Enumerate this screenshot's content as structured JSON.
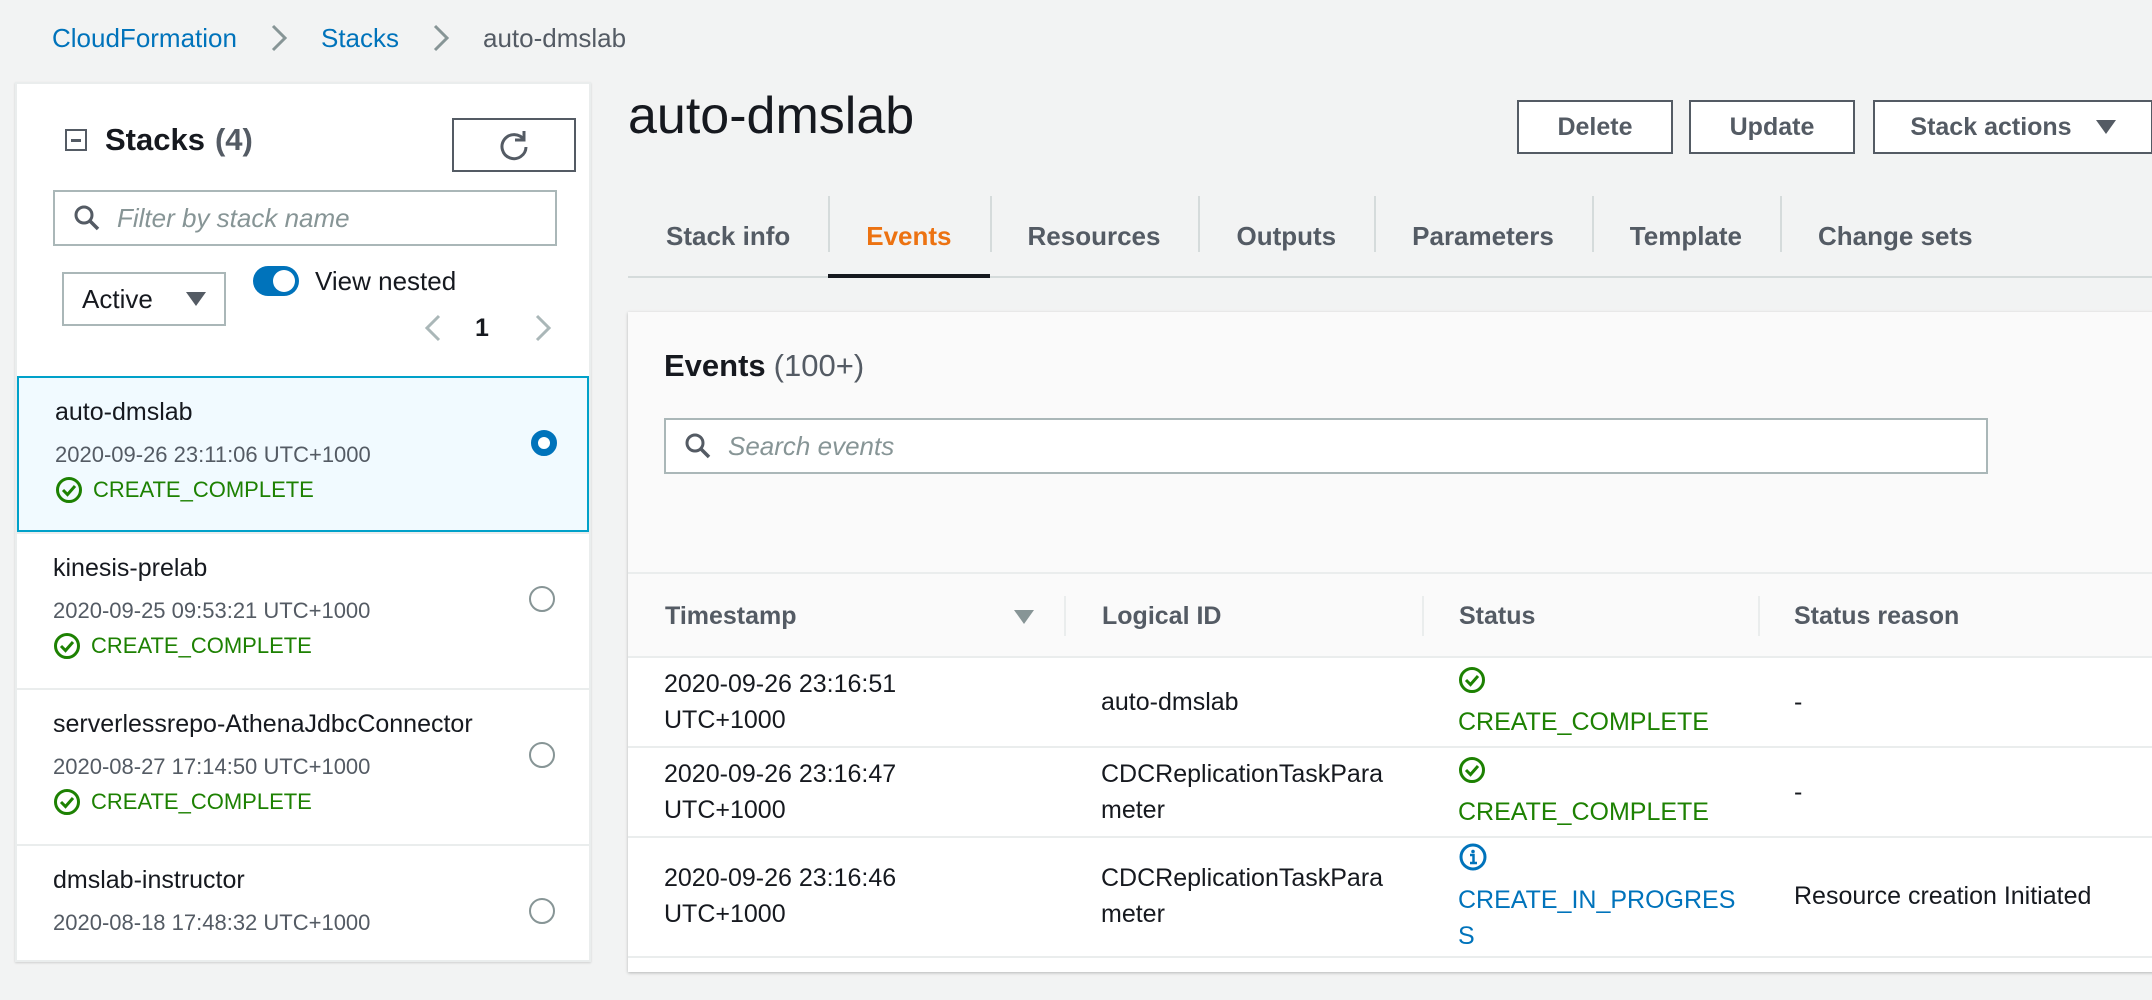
{
  "breadcrumb": {
    "items": [
      "CloudFormation",
      "Stacks"
    ],
    "current": "auto-dmslab"
  },
  "sidebar": {
    "title": "Stacks",
    "count": "(4)",
    "filter_placeholder": "Filter by stack name",
    "status_filter": "Active",
    "view_nested_label": "View nested",
    "page": "1",
    "stacks": [
      {
        "name": "auto-dmslab",
        "date": "2020-09-26 23:11:06 UTC+1000",
        "status": "CREATE_COMPLETE",
        "selected": true
      },
      {
        "name": "kinesis-prelab",
        "date": "2020-09-25 09:53:21 UTC+1000",
        "status": "CREATE_COMPLETE",
        "selected": false
      },
      {
        "name": "serverlessrepo-AthenaJdbcConnector",
        "date": "2020-08-27 17:14:50 UTC+1000",
        "status": "CREATE_COMPLETE",
        "selected": false
      },
      {
        "name": "dmslab-instructor",
        "date": "2020-08-18 17:48:32 UTC+1000",
        "status": "",
        "selected": false
      }
    ]
  },
  "main": {
    "title": "auto-dmslab",
    "buttons": {
      "delete": "Delete",
      "update": "Update",
      "stack_actions": "Stack actions"
    },
    "tabs": [
      "Stack info",
      "Events",
      "Resources",
      "Outputs",
      "Parameters",
      "Template",
      "Change sets"
    ],
    "active_tab": "Events"
  },
  "events": {
    "title": "Events",
    "count": "(100+)",
    "search_placeholder": "Search events",
    "columns": [
      "Timestamp",
      "Logical ID",
      "Status",
      "Status reason"
    ],
    "rows": [
      {
        "timestamp": [
          "2020-09-26 23:16:51",
          "UTC+1000"
        ],
        "logical_id": [
          "auto-dmslab"
        ],
        "status": "CREATE_COMPLETE",
        "status_lines": [
          "CREATE_COMPLETE"
        ],
        "reason": "-"
      },
      {
        "timestamp": [
          "2020-09-26 23:16:47",
          "UTC+1000"
        ],
        "logical_id": [
          "CDCReplicationTaskPara",
          "meter"
        ],
        "status": "CREATE_COMPLETE",
        "status_lines": [
          "CREATE_COMPLETE"
        ],
        "reason": "-"
      },
      {
        "timestamp": [
          "2020-09-26 23:16:46",
          "UTC+1000"
        ],
        "logical_id": [
          "CDCReplicationTaskPara",
          "meter"
        ],
        "status": "CREATE_IN_PROGRESS",
        "status_lines": [
          "CREATE_IN_PROGRES",
          "S"
        ],
        "reason": "Resource creation Initiated"
      }
    ]
  },
  "colors": {
    "link": "#0073bb",
    "success": "#1d8102",
    "active_tab": "#ec7211",
    "selected_bg": "#f1faff",
    "selected_border": "#00a1c9"
  }
}
